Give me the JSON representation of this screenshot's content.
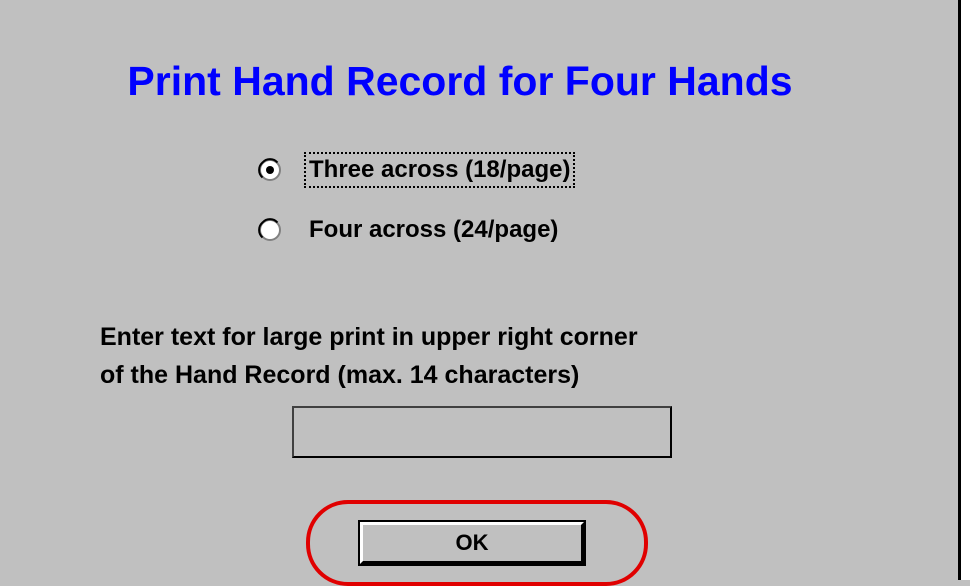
{
  "dialog": {
    "title": "Print Hand Record for Four Hands",
    "title_color": "#0000ff",
    "background": "#c0c0c0"
  },
  "layout_options": {
    "items": [
      {
        "label": "Three across (18/page)",
        "selected": true,
        "focused": true
      },
      {
        "label": "Four across (24/page)",
        "selected": false,
        "focused": false
      }
    ]
  },
  "corner_text": {
    "prompt_line1": "Enter text for large print in upper right corner",
    "prompt_line2": "of the Hand Record (max. 14 characters)",
    "value": "",
    "max_length": 14
  },
  "buttons": {
    "ok_label": "OK"
  },
  "annotation": {
    "highlight_color": "#e00000",
    "highlight_target": "ok-button"
  }
}
